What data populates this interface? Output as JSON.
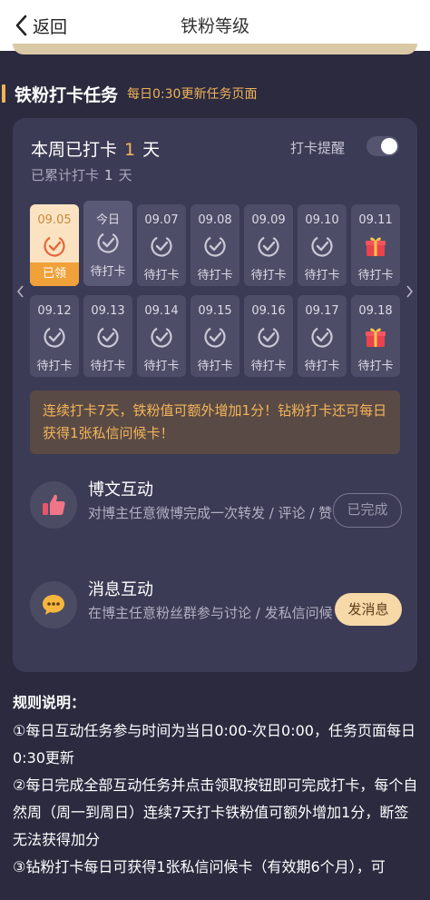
{
  "nav": {
    "back_label": "返回",
    "title": "铁粉等级"
  },
  "section": {
    "title": "铁粉打卡任务",
    "subtitle": "每日0:30更新任务页面"
  },
  "checkin": {
    "week_prefix": "本周已打卡",
    "week_count": "1",
    "week_unit": "天",
    "total_prefix": "已累计打卡",
    "total_count": "1",
    "total_unit": "天",
    "reminder_label": "打卡提醒",
    "reminder_on": false
  },
  "days": [
    {
      "date": "09.05",
      "status": "已领",
      "icon": "check-icon",
      "state": "done"
    },
    {
      "date": "今日",
      "status": "待打卡",
      "icon": "check-icon",
      "state": "today"
    },
    {
      "date": "09.07",
      "status": "待打卡",
      "icon": "check-icon",
      "state": "pending"
    },
    {
      "date": "09.08",
      "status": "待打卡",
      "icon": "check-icon",
      "state": "pending"
    },
    {
      "date": "09.09",
      "status": "待打卡",
      "icon": "check-icon",
      "state": "pending"
    },
    {
      "date": "09.10",
      "status": "待打卡",
      "icon": "check-icon",
      "state": "pending"
    },
    {
      "date": "09.11",
      "status": "待打卡",
      "icon": "gift-icon",
      "state": "pending"
    },
    {
      "date": "09.12",
      "status": "待打卡",
      "icon": "check-icon",
      "state": "pending"
    },
    {
      "date": "09.13",
      "status": "待打卡",
      "icon": "check-icon",
      "state": "pending"
    },
    {
      "date": "09.14",
      "status": "待打卡",
      "icon": "check-icon",
      "state": "pending"
    },
    {
      "date": "09.15",
      "status": "待打卡",
      "icon": "check-icon",
      "state": "pending"
    },
    {
      "date": "09.16",
      "status": "待打卡",
      "icon": "check-icon",
      "state": "pending"
    },
    {
      "date": "09.17",
      "status": "待打卡",
      "icon": "check-icon",
      "state": "pending"
    },
    {
      "date": "09.18",
      "status": "待打卡",
      "icon": "gift-icon",
      "state": "pending"
    }
  ],
  "notice": "连续打卡7天，铁粉值可额外增加1分！钻粉打卡还可每日获得1张私信问候卡！",
  "tasks": [
    {
      "name": "博文互动",
      "desc": "对博主任意微博完成一次转发 / 评论 / 赞",
      "button": "已完成",
      "icon": "thumbs-up-icon"
    },
    {
      "name": "消息互动",
      "desc": "在博主任意粉丝群参与讨论 / 发私信问候",
      "button": "发消息",
      "icon": "chat-bubble-icon"
    }
  ],
  "rules": {
    "heading": "规则说明：",
    "items": [
      "①每日互动任务参与时间为当日0:00-次日0:00，任务页面每日0:30更新",
      "②每日完成全部互动任务并点击领取按钮即可完成打卡，每个自然周（周一到周日）连续7天打卡铁粉值可额外增加1分，断签无法获得加分",
      "③钻粉打卡每日可获得1张私信问候卡（有效期6个月），可"
    ]
  },
  "colors": {
    "accent": "#f3b55a",
    "background": "#2b2a3f",
    "card": "#3c3b55"
  }
}
